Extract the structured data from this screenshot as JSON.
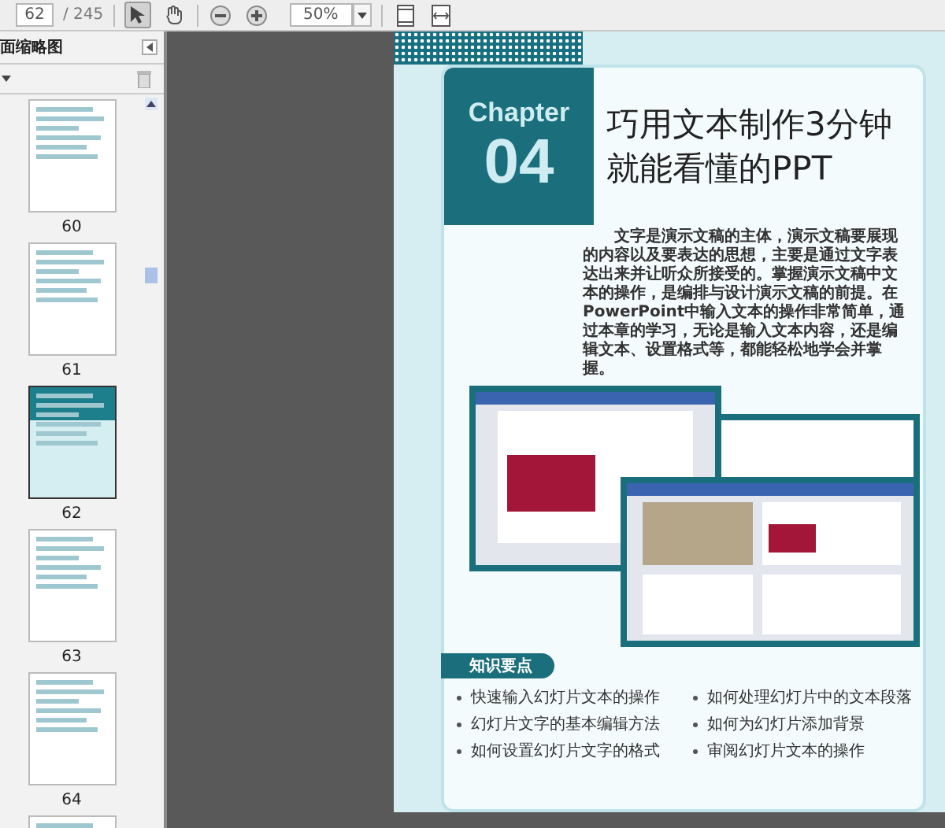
{
  "toolbar": {
    "page_number": "62",
    "page_count": "/ 245",
    "tools": [
      {
        "kind": "select",
        "selected": true
      },
      {
        "kind": "hand",
        "selected": false
      }
    ],
    "zoom": "50%"
  },
  "sidebar": {
    "title": "面缩略图",
    "thumbnails": [
      {
        "label": "60",
        "kind": "content",
        "selected": false
      },
      {
        "label": "61",
        "kind": "content",
        "selected": false
      },
      {
        "label": "62",
        "kind": "chapter",
        "selected": true
      },
      {
        "label": "63",
        "kind": "content",
        "selected": false
      },
      {
        "label": "64",
        "kind": "content",
        "selected": false
      },
      {
        "kind": "content",
        "selected": false
      }
    ]
  },
  "page": {
    "chapter_label": "Chapter",
    "chapter_number": "04",
    "title_lines": [
      "巧用文本制作3分钟",
      "就能看懂的PPT"
    ],
    "intro": "文字是演示文稿的主体，演示文稿要展现的内容以及要表达的思想，主要是通过文字表达出来并让听众所接受的。掌握演示文稿中文本的操作，是编排与设计演示文稿的前提。在PowerPoint中输入文本的操作非常简单，通过本章的学习，无论是输入文本内容，还是编辑文本、设置格式等，都能轻松地学会并掌握。",
    "section_heading": "知识要点",
    "key_points": [
      "快速输入幻灯片文本的操作",
      "如何处理幻灯片中的文本段落",
      "幻灯片文字的基本编辑方法",
      "如何为幻灯片添加背景",
      "如何设置幻灯片文字的格式",
      "审阅幻灯片文本的操作"
    ]
  }
}
